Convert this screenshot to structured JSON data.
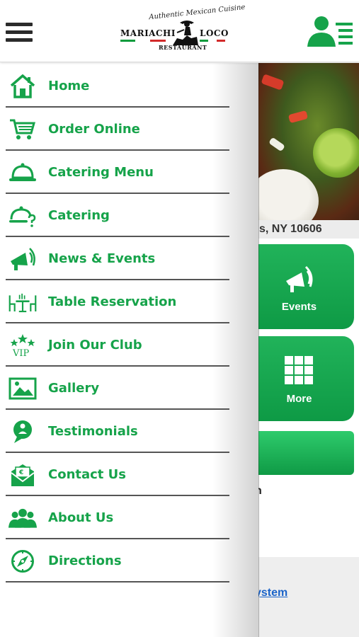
{
  "header": {
    "logo": {
      "tagline": "Authentic Mexican Cuisine",
      "brand_left": "MARIACHI",
      "brand_right": "LOCO",
      "subtitle": "RESTAURANT"
    },
    "menu_icon": "hamburger-icon",
    "user_icon": "user-list-icon"
  },
  "background": {
    "address_fragment": "s, NY 10606",
    "tiles": [
      {
        "label": "Events",
        "icon": "megaphone-icon"
      },
      {
        "label": "More",
        "icon": "grid-icon"
      }
    ],
    "partial_text": "n",
    "link_fragment": "ystem"
  },
  "drawer": {
    "items": [
      {
        "label": "Home",
        "icon": "home-icon"
      },
      {
        "label": "Order Online",
        "icon": "cart-icon"
      },
      {
        "label": "Catering Menu",
        "icon": "cloche-icon"
      },
      {
        "label": "Catering",
        "icon": "catering-question-icon"
      },
      {
        "label": "News & Events",
        "icon": "megaphone-icon"
      },
      {
        "label": "Table Reservation",
        "icon": "table-icon"
      },
      {
        "label": "Join Our Club",
        "icon": "vip-stars-icon"
      },
      {
        "label": "Gallery",
        "icon": "image-icon"
      },
      {
        "label": "Testimonials",
        "icon": "testimonial-bubble-icon"
      },
      {
        "label": "Contact Us",
        "icon": "envelope-icon"
      },
      {
        "label": "About Us",
        "icon": "group-icon"
      },
      {
        "label": "Directions",
        "icon": "compass-icon"
      }
    ],
    "vip_text": "VIP"
  },
  "colors": {
    "accent_green": "#16a34a",
    "tile_green": "#12a54d",
    "link_blue": "#1a63c9"
  }
}
